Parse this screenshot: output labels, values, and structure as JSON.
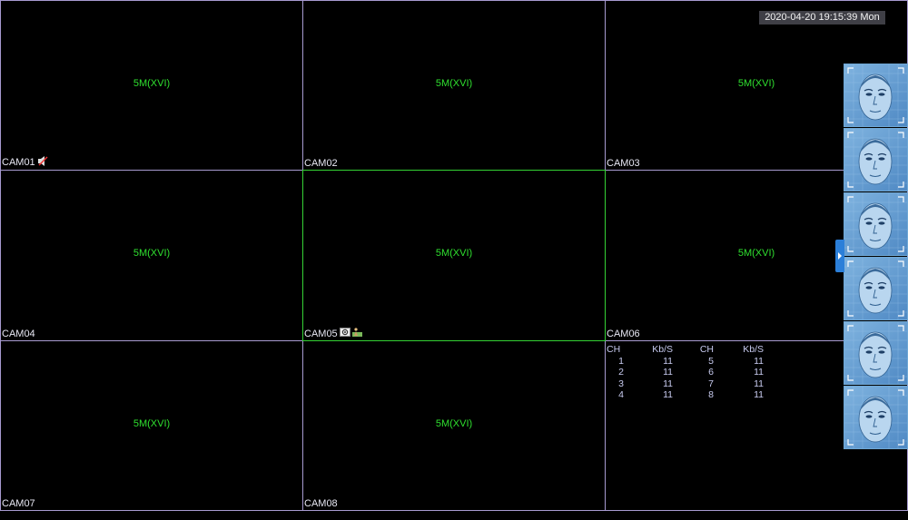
{
  "datetime": "2020-04-20 19:15:39 Mon",
  "cameras": [
    {
      "name": "CAM01",
      "resolution": "5M(XVI)",
      "icon": "speaker-icon"
    },
    {
      "name": "CAM02",
      "resolution": "5M(XVI)"
    },
    {
      "name": "CAM03",
      "resolution": "5M(XVI)"
    },
    {
      "name": "CAM04",
      "resolution": "5M(XVI)"
    },
    {
      "name": "CAM05",
      "resolution": "5M(XVI)",
      "icon": "record-icon",
      "icon2": "motion-icon",
      "selected": true
    },
    {
      "name": "CAM06",
      "resolution": "5M(XVI)"
    },
    {
      "name": "CAM07",
      "resolution": "5M(XVI)"
    },
    {
      "name": "CAM08",
      "resolution": "5M(XVI)"
    }
  ],
  "bitrate": {
    "headers": [
      "CH",
      "Kb/S",
      "CH",
      "Kb/S"
    ],
    "rows": [
      [
        "1",
        "11",
        "5",
        "11"
      ],
      [
        "2",
        "11",
        "6",
        "11"
      ],
      [
        "3",
        "11",
        "7",
        "11"
      ],
      [
        "4",
        "11",
        "8",
        "11"
      ]
    ]
  },
  "face_panel": {
    "count": 6,
    "icon": "face-thumbnail-icon"
  },
  "colors": {
    "border": "#a79ad0",
    "selected_border": "#34d234",
    "resolution_text": "#2fe02f",
    "panel_blue": "#2b7fd9"
  }
}
